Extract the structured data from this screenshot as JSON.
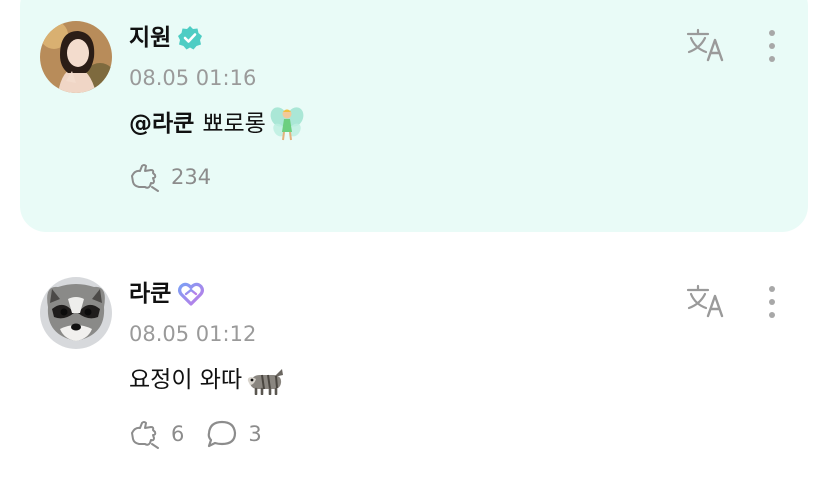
{
  "comments": [
    {
      "author": "지원",
      "badge": "verified",
      "timestamp": "08.05 01:16",
      "mention": "@라쿤",
      "text": "뾰로롱",
      "emoji": "fairy",
      "likes": "234",
      "highlighted": true
    },
    {
      "author": "라쿤",
      "badge": "fan-heart",
      "timestamp": "08.05 01:12",
      "text": "요정이 와따",
      "emoji": "raccoon",
      "likes": "6",
      "replies": "3",
      "highlighted": false
    }
  ],
  "colors": {
    "highlight_bg": "#e9fbf7",
    "verified": "#4ecdc4",
    "fan_heart_start": "#7b9ff5",
    "fan_heart_end": "#c07be6",
    "meta": "#9a9a9a"
  }
}
